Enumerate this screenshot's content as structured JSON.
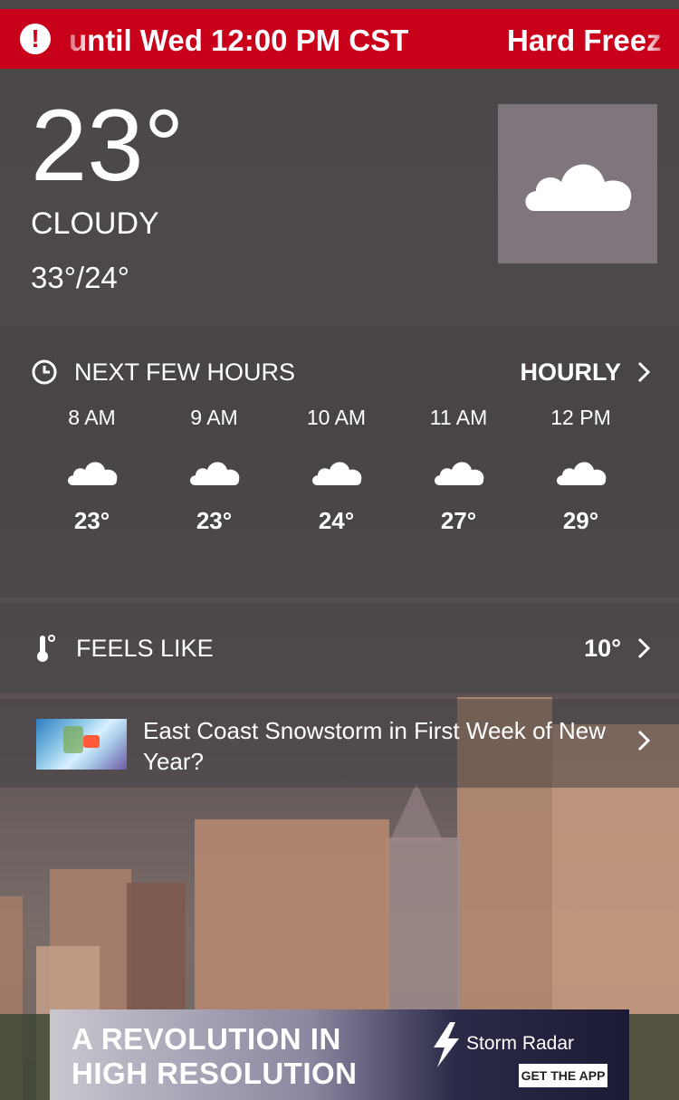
{
  "alert": {
    "icon": "exclamation-icon",
    "text": "until Wed 12:00 PM CST",
    "text_next": "Hard Freez"
  },
  "current": {
    "temperature": "23°",
    "condition": "CLOUDY",
    "hi_lo": "33°/24°",
    "icon": "cloud-icon"
  },
  "next_hours": {
    "title": "NEXT FEW HOURS",
    "link_label": "HOURLY",
    "hours": [
      {
        "time": "8 AM",
        "temp": "23°",
        "icon": "cloud-icon"
      },
      {
        "time": "9 AM",
        "temp": "23°",
        "icon": "cloud-icon"
      },
      {
        "time": "10 AM",
        "temp": "24°",
        "icon": "cloud-icon"
      },
      {
        "time": "11 AM",
        "temp": "27°",
        "icon": "cloud-icon"
      },
      {
        "time": "12 PM",
        "temp": "29°",
        "icon": "cloud-icon"
      }
    ]
  },
  "feels_like": {
    "title": "FEELS LIKE",
    "value": "10°"
  },
  "news": {
    "title": "East Coast Snowstorm in First Week of New Year?"
  },
  "ad": {
    "line1": "A REVOLUTION IN",
    "line2": "HIGH RESOLUTION",
    "brand": "Storm Radar",
    "cta": "GET THE APP"
  },
  "colors": {
    "alert_red": "#c8001a",
    "icon_box": "#7f767d"
  }
}
